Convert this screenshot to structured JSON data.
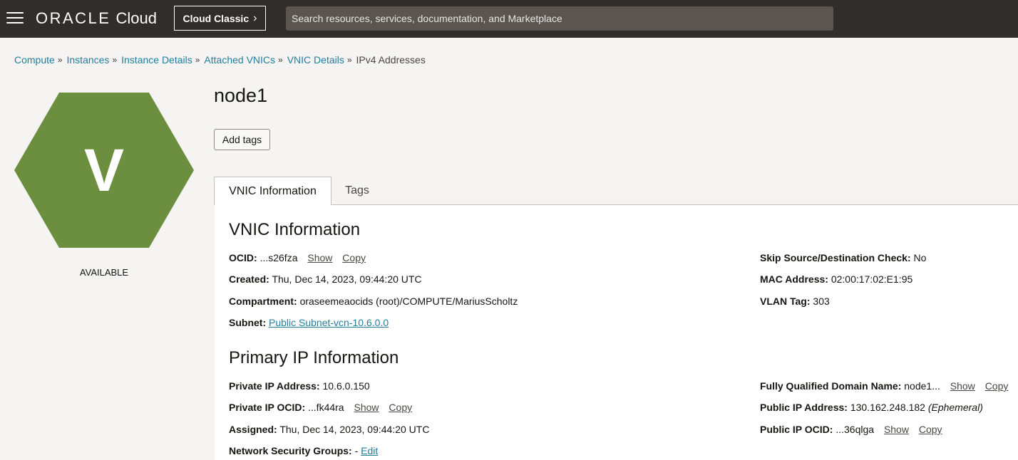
{
  "header": {
    "brand_oracle": "ORACLE",
    "brand_cloud": "Cloud",
    "classic_button": "Cloud Classic",
    "search_placeholder": "Search resources, services, documentation, and Marketplace"
  },
  "breadcrumb": [
    "Compute",
    "Instances",
    "Instance Details",
    "Attached VNICs",
    "VNIC Details",
    "IPv4 Addresses"
  ],
  "resource": {
    "icon_letter": "V",
    "icon_color": "#6b8e3f",
    "status": "AVAILABLE",
    "name": "node1",
    "add_tags_label": "Add tags"
  },
  "tabs": [
    "VNIC Information",
    "Tags"
  ],
  "vnic_info": {
    "heading": "VNIC Information",
    "ocid_label": "OCID:",
    "ocid_value": "...s26fza",
    "show": "Show",
    "copy": "Copy",
    "created_label": "Created:",
    "created_value": "Thu, Dec 14, 2023, 09:44:20 UTC",
    "compartment_label": "Compartment:",
    "compartment_value": "oraseemeaocids (root)/COMPUTE/MariusScholtz",
    "subnet_label": "Subnet:",
    "subnet_value": "Public Subnet-vcn-10.6.0.0",
    "skip_label": "Skip Source/Destination Check:",
    "skip_value": "No",
    "mac_label": "MAC Address:",
    "mac_value": "02:00:17:02:E1:95",
    "vlan_label": "VLAN Tag:",
    "vlan_value": "303"
  },
  "primary_ip": {
    "heading": "Primary IP Information",
    "private_ip_label": "Private IP Address:",
    "private_ip_value": "10.6.0.150",
    "private_ocid_label": "Private IP OCID:",
    "private_ocid_value": "...fk44ra",
    "assigned_label": "Assigned:",
    "assigned_value": "Thu, Dec 14, 2023, 09:44:20 UTC",
    "nsg_label": "Network Security Groups:",
    "nsg_value": "-",
    "edit": "Edit",
    "fqdn_label": "Fully Qualified Domain Name:",
    "fqdn_value": "node1...",
    "public_ip_label": "Public IP Address:",
    "public_ip_value": "130.162.248.182",
    "public_ip_type": "(Ephemeral)",
    "public_ocid_label": "Public IP OCID:",
    "public_ocid_value": "...36qlga"
  }
}
